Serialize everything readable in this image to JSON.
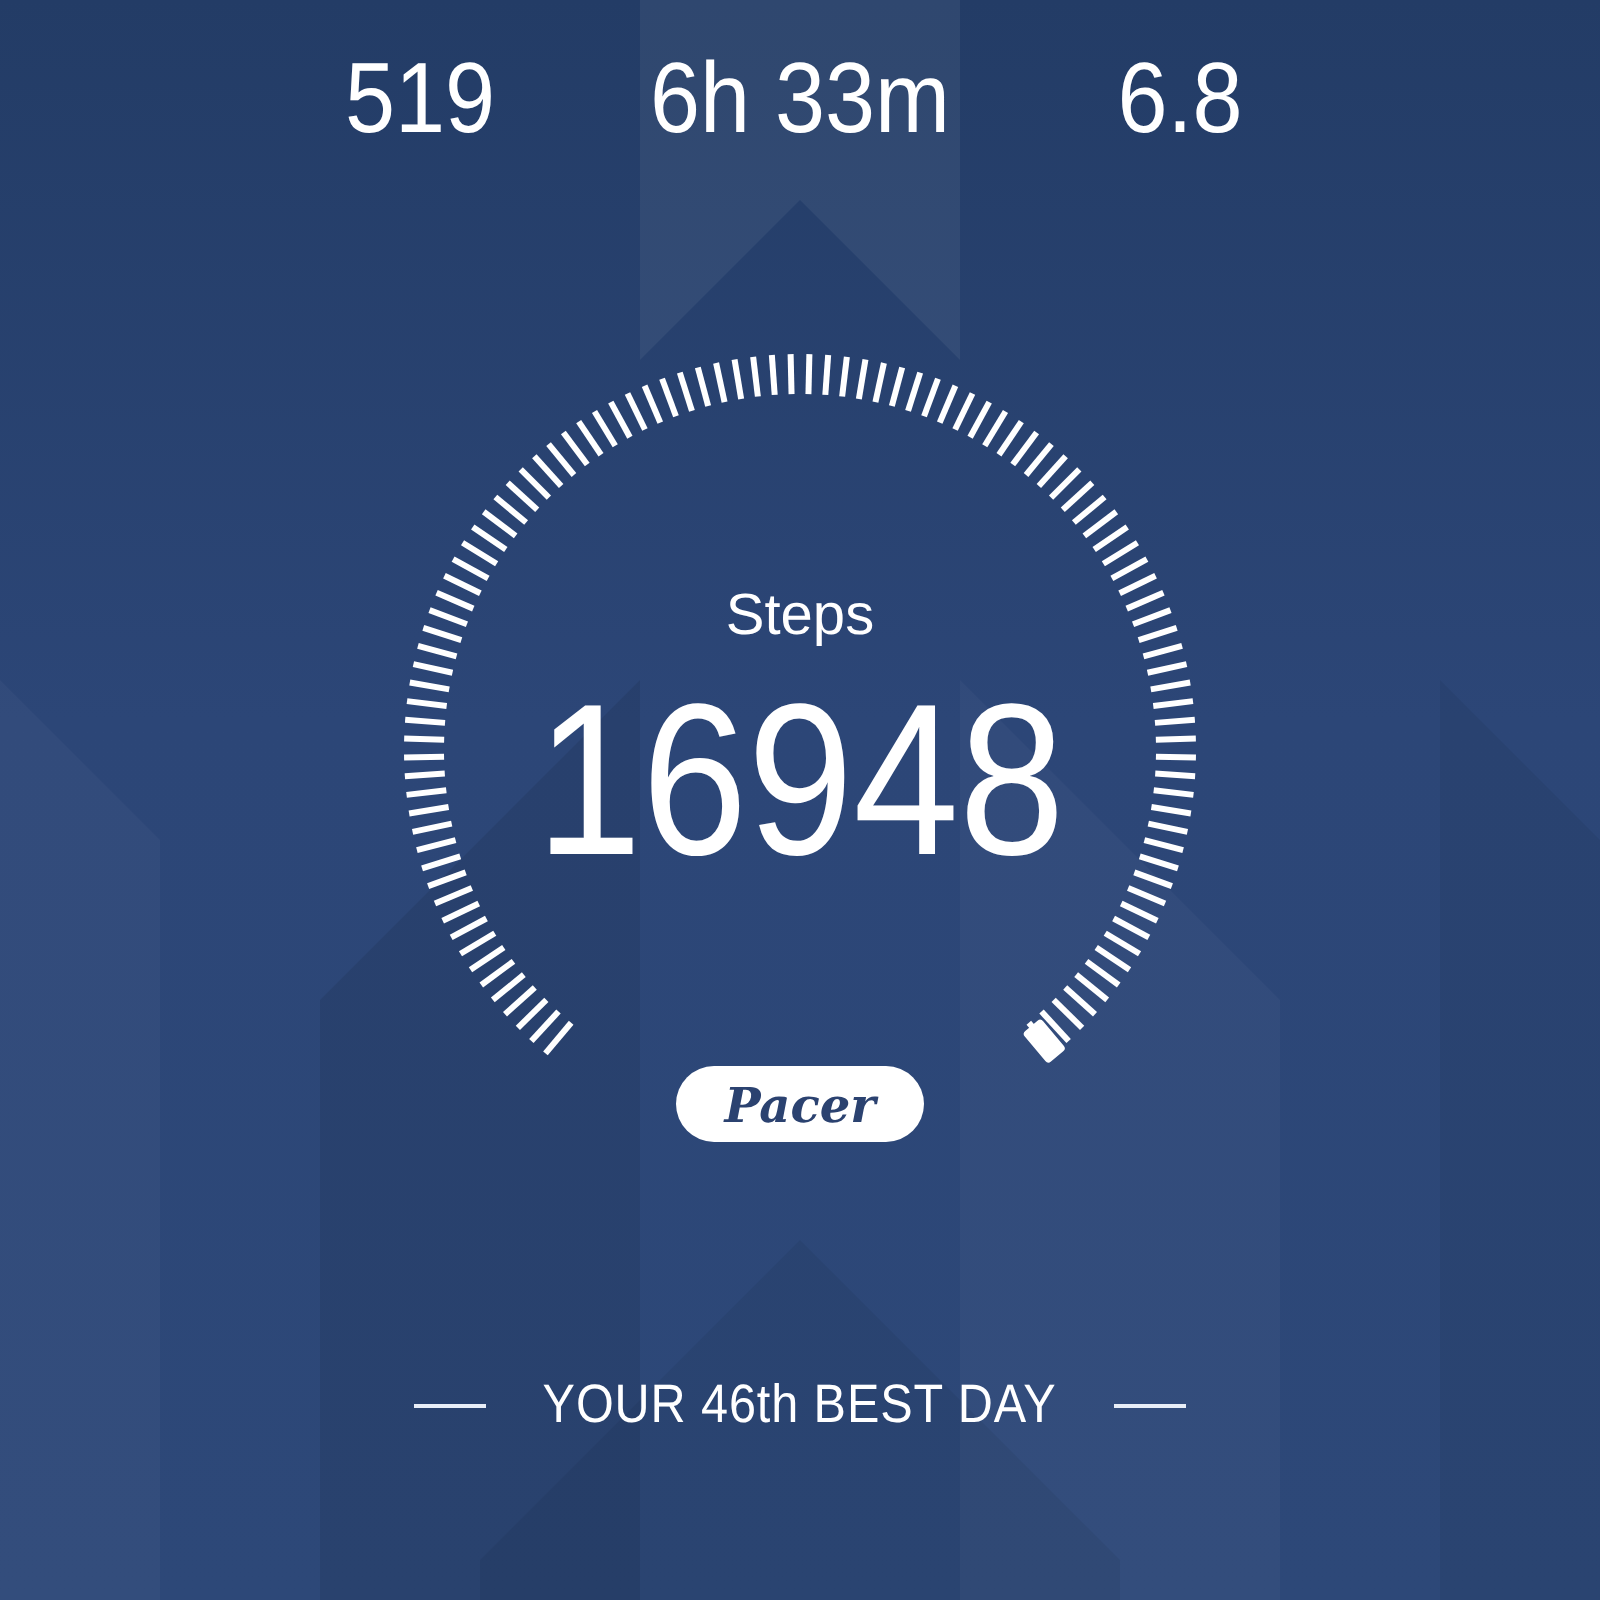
{
  "stats": [
    {
      "value": "519"
    },
    {
      "value": "6h 33m"
    },
    {
      "value": "6.8"
    }
  ],
  "gauge": {
    "label": "Steps",
    "value": "16948"
  },
  "brand": "Pacer",
  "footer": "YOUR 46th BEST DAY"
}
